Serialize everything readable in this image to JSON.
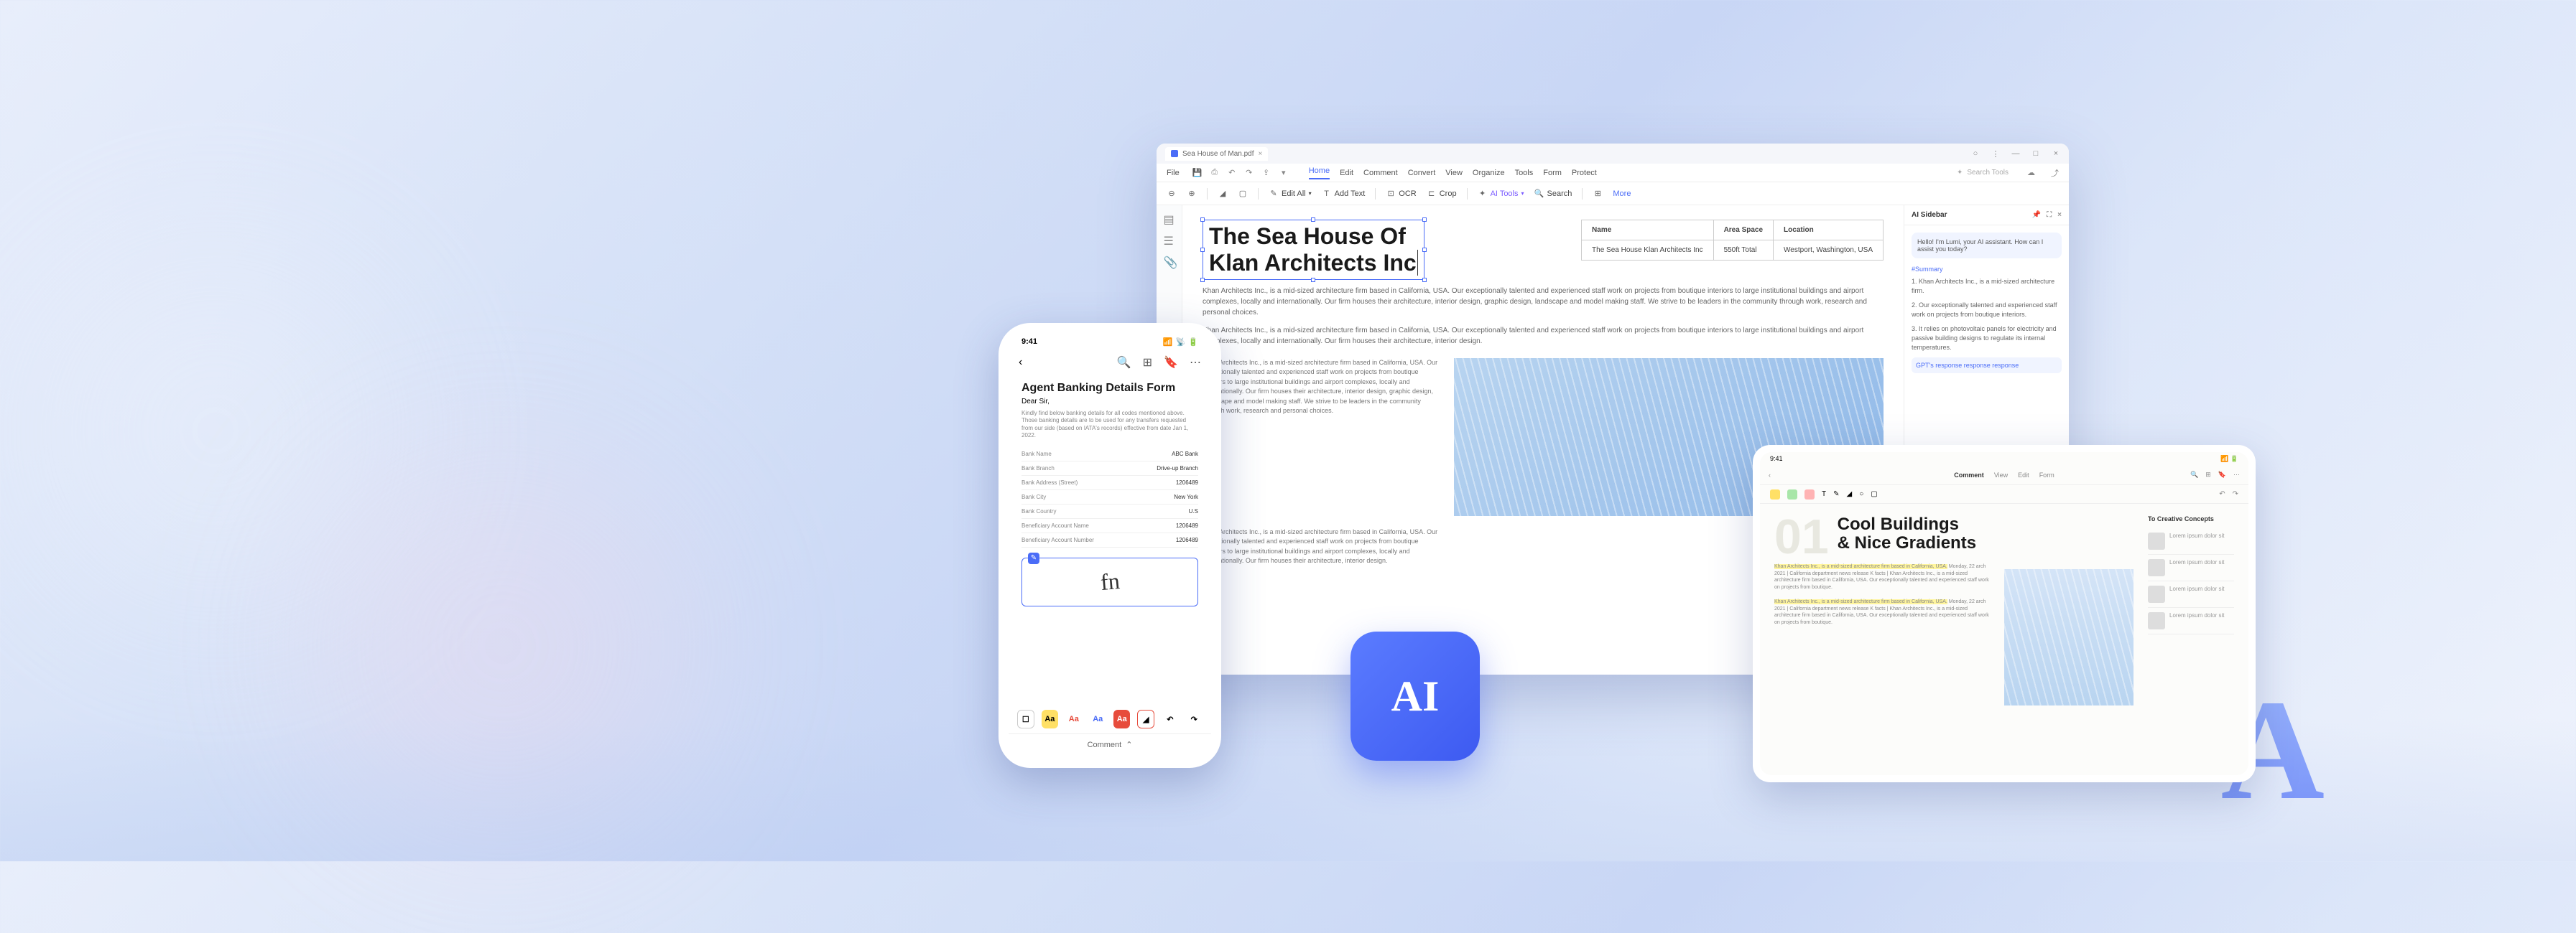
{
  "desktop": {
    "tab_name": "Sea House of Man.pdf",
    "menu": {
      "file": "File",
      "home": "Home",
      "edit": "Edit",
      "comment": "Comment",
      "convert": "Convert",
      "view": "View",
      "organize": "Organize",
      "tools": "Tools",
      "form": "Form",
      "protect": "Protect"
    },
    "search_tools_placeholder": "Search Tools",
    "toolbar": {
      "edit_all": "Edit All",
      "add_text": "Add Text",
      "ocr": "OCR",
      "crop": "Crop",
      "ai_tools": "AI Tools",
      "search": "Search",
      "more": "More"
    },
    "doc": {
      "title_line1": "The Sea House Of",
      "title_line2": "Klan Architects Inc",
      "table": {
        "h1": "Name",
        "h2": "Area Space",
        "h3": "Location",
        "r1c1": "The Sea House Klan Architects Inc",
        "r1c2": "550ft Total",
        "r1c3": "Westport, Washington, USA"
      },
      "para1": "Khan Architects Inc., is a mid-sized architecture firm based in California, USA. Our exceptionally talented and experienced staff work on projects from boutique interiors to large institutional buildings and airport complexes, locally and internationally. Our firm houses their architecture, interior design, graphic design, landscape and model making staff. We strive to be leaders in the community through work, research and personal choices.",
      "para2": "Khan Architects Inc., is a mid-sized architecture firm based in California, USA. Our exceptionally talented and experienced staff work on projects from boutique interiors to large institutional buildings and airport complexes, locally and internationally. Our firm houses their architecture, interior design.",
      "col1": "Khan Architects Inc., is a mid-sized architecture firm based in California, USA. Our exceptionally talented and experienced staff work on projects from boutique interiors to large institutional buildings and airport complexes, locally and internationally. Our firm houses their architecture, interior design, graphic design, landscape and model making staff. We strive to be leaders in the community through work, research and personal choices.",
      "col2": "Khan Architects Inc., is a mid-sized architecture firm based in California, USA. Our exceptionally talented and experienced staff work on projects from boutique interiors to large institutional buildings and airport complexes, locally and internationally. Our firm houses their architecture, interior design."
    },
    "ai": {
      "title": "AI Sidebar",
      "greeting": "Hello! I'm Lumi, your AI assistant. How can I assist you today?",
      "tag": "#Summary",
      "item1": "1. Khan Architects Inc., is a mid-sized architecture firm.",
      "item2": "2. Our exceptionally talented and experienced staff work on projects from boutique interiors.",
      "item3": "3. It relies on photovoltaic panels for electricity and passive building designs to regulate its internal temperatures.",
      "more": "GPT's response response response"
    }
  },
  "phone": {
    "time": "9:41",
    "title": "Agent Banking Details Form",
    "dear": "Dear Sir,",
    "instruct": "Kindly find below banking details for all codes mentioned above. Those banking details are to be used for any transfers requested from our side (based on IATA's records) effective from date Jan 1, 2022.",
    "fields": [
      {
        "label": "Bank Name",
        "val": "ABC Bank"
      },
      {
        "label": "Bank Branch",
        "val": "Drive-up Branch"
      },
      {
        "label": "Bank Address (Street)",
        "val": "1206489"
      },
      {
        "label": "Bank City",
        "val": "New York"
      },
      {
        "label": "Bank Country",
        "val": "U.S"
      },
      {
        "label": "Beneficiary Account Name",
        "val": "1206489"
      },
      {
        "label": "Beneficiary Account Number",
        "val": "1206489"
      }
    ],
    "format_labels": [
      "Aa",
      "Aa",
      "Aa",
      "Aa",
      "Aa"
    ],
    "comment": "Comment"
  },
  "tablet": {
    "time": "9:41",
    "tabs": [
      "Comment",
      "View",
      "Edit",
      "Form"
    ],
    "num": "01",
    "title_l1": "Cool Buildings",
    "title_l2": "& Nice Gradients",
    "side_title": "To Creative Concepts",
    "col_text": "Monday, 22 arch 2021 | California department news release K facts | Khan Architects Inc., is a mid-sized architecture firm based in California, USA. Our exceptionally talented and experienced staff work on projects from boutique.",
    "hl_text": "Khan Architects Inc., is a mid-sized architecture firm based in California, USA."
  },
  "ai_badge": "AI",
  "big_a": "A"
}
